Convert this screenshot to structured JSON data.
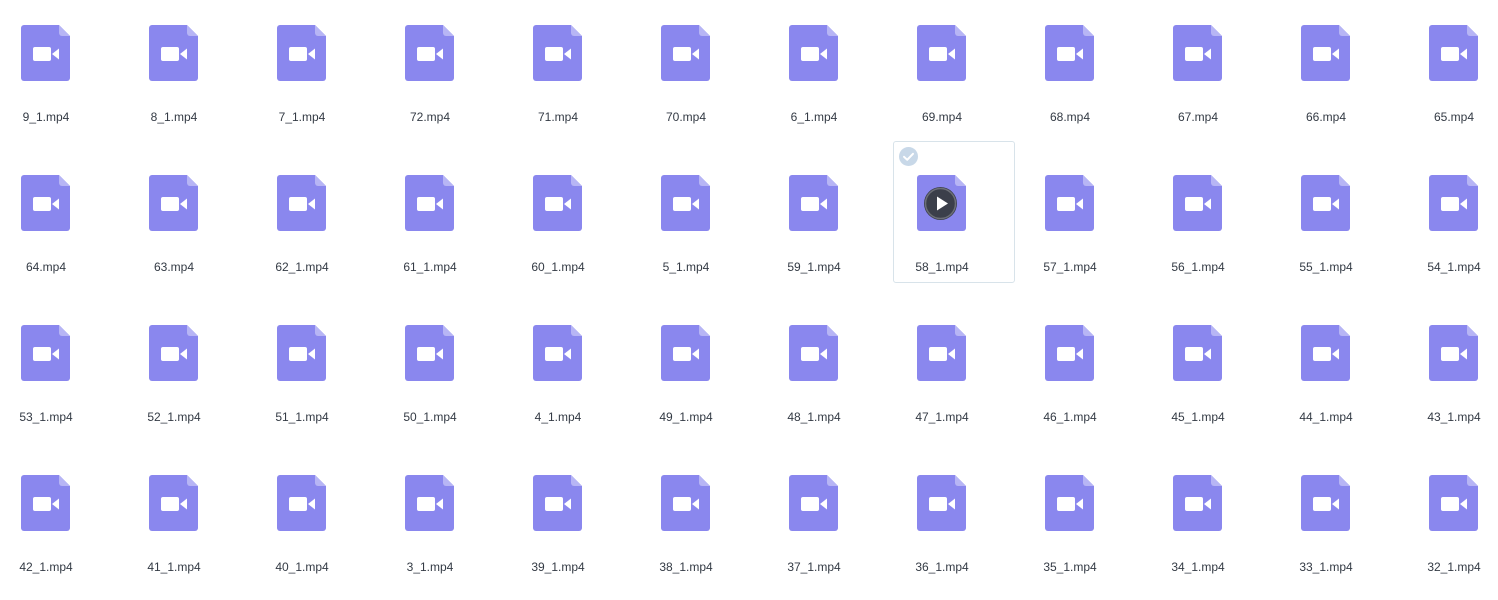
{
  "colors": {
    "file_icon": "#8a87ee",
    "file_fold": "#b7b5f5",
    "selected_border": "#d8e3ea",
    "check_badge": "#c8d8e8",
    "play_button": "#3b3f4a",
    "label_text": "#333a44"
  },
  "icons": {
    "file": "video-file-icon",
    "play": "play-icon",
    "check": "check-icon"
  },
  "selected_index": 19,
  "files": [
    {
      "name": "9_1.mp4"
    },
    {
      "name": "8_1.mp4"
    },
    {
      "name": "7_1.mp4"
    },
    {
      "name": "72.mp4"
    },
    {
      "name": "71.mp4"
    },
    {
      "name": "70.mp4"
    },
    {
      "name": "6_1.mp4"
    },
    {
      "name": "69.mp4"
    },
    {
      "name": "68.mp4"
    },
    {
      "name": "67.mp4"
    },
    {
      "name": "66.mp4"
    },
    {
      "name": "65.mp4"
    },
    {
      "name": "64.mp4"
    },
    {
      "name": "63.mp4"
    },
    {
      "name": "62_1.mp4"
    },
    {
      "name": "61_1.mp4"
    },
    {
      "name": "60_1.mp4"
    },
    {
      "name": "5_1.mp4"
    },
    {
      "name": "59_1.mp4"
    },
    {
      "name": "58_1.mp4"
    },
    {
      "name": "57_1.mp4"
    },
    {
      "name": "56_1.mp4"
    },
    {
      "name": "55_1.mp4"
    },
    {
      "name": "54_1.mp4"
    },
    {
      "name": "53_1.mp4"
    },
    {
      "name": "52_1.mp4"
    },
    {
      "name": "51_1.mp4"
    },
    {
      "name": "50_1.mp4"
    },
    {
      "name": "4_1.mp4"
    },
    {
      "name": "49_1.mp4"
    },
    {
      "name": "48_1.mp4"
    },
    {
      "name": "47_1.mp4"
    },
    {
      "name": "46_1.mp4"
    },
    {
      "name": "45_1.mp4"
    },
    {
      "name": "44_1.mp4"
    },
    {
      "name": "43_1.mp4"
    },
    {
      "name": "42_1.mp4"
    },
    {
      "name": "41_1.mp4"
    },
    {
      "name": "40_1.mp4"
    },
    {
      "name": "3_1.mp4"
    },
    {
      "name": "39_1.mp4"
    },
    {
      "name": "38_1.mp4"
    },
    {
      "name": "37_1.mp4"
    },
    {
      "name": "36_1.mp4"
    },
    {
      "name": "35_1.mp4"
    },
    {
      "name": "34_1.mp4"
    },
    {
      "name": "33_1.mp4"
    },
    {
      "name": "32_1.mp4"
    }
  ]
}
